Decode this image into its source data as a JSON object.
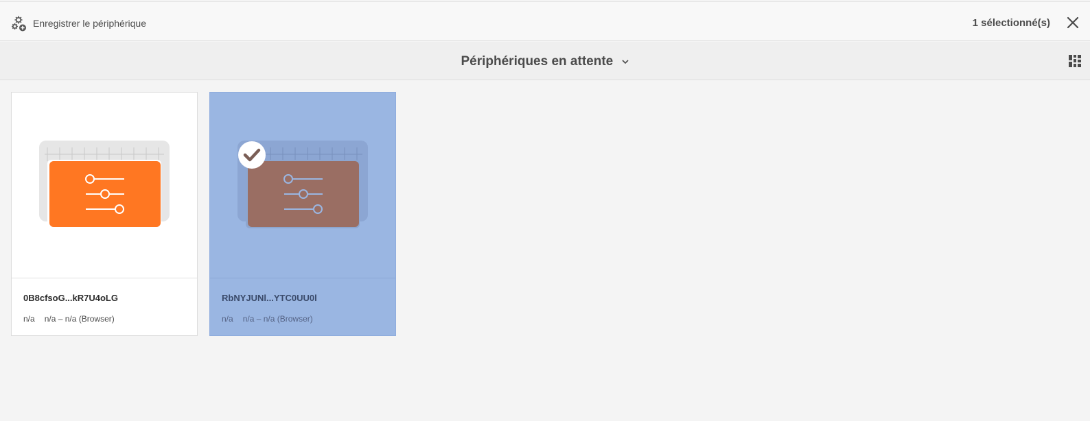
{
  "toolbar": {
    "register_label": "Enregistrer le périphérique",
    "selection_count": "1 sélectionné(s)"
  },
  "view": {
    "title": "Périphériques en attente"
  },
  "cards": [
    {
      "name": "0B8cfsoG...kR7U4oLG",
      "meta1": "n/a",
      "meta2": "n/a – n/a (Browser)",
      "selected": false
    },
    {
      "name": "RbNYJUNl...YTC0UU0l",
      "meta1": "n/a",
      "meta2": "n/a – n/a (Browser)",
      "selected": true
    }
  ],
  "colors": {
    "accent_orange": "#ff7722",
    "selected_overlay": "#9ab6e2",
    "selected_thumb": "#9a6e63"
  },
  "icons": {
    "register": "gear-plus-icon",
    "close": "close-icon",
    "dropdown": "chevron-down-icon",
    "view_switch": "grid-view-icon",
    "device": "device-settings-icon",
    "selected": "checkmark-icon"
  }
}
